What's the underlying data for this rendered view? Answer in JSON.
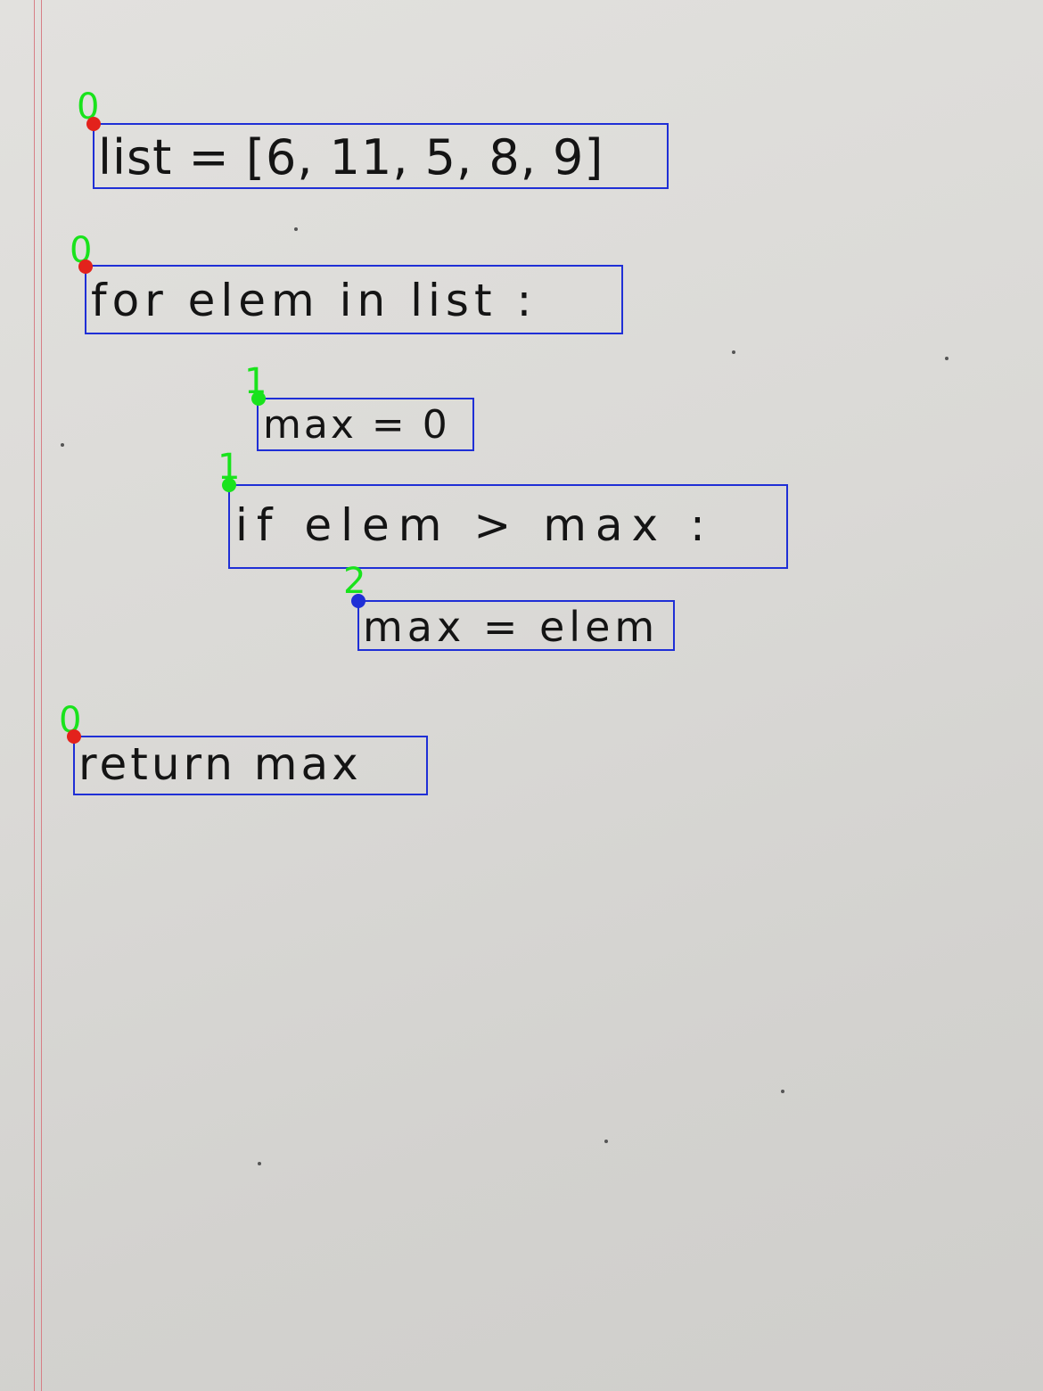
{
  "lines": [
    {
      "text": "list = [6, 11, 5, 8, 9]",
      "level": "0"
    },
    {
      "text": "for elem in list :",
      "level": "0"
    },
    {
      "text": "max = 0",
      "level": "1"
    },
    {
      "text": "if elem > max :",
      "level": "1"
    },
    {
      "text": "max = elem",
      "level": "2"
    },
    {
      "text": "return max",
      "level": "0"
    }
  ],
  "colors": {
    "bbox": "#1f2fd6",
    "label_text": "#19e31c",
    "marker_level_0": "#e3221c",
    "marker_level_1": "#19e31c",
    "marker_level_2": "#1f2fd6",
    "ink": "#141414",
    "margin_line": "#d77f86"
  }
}
